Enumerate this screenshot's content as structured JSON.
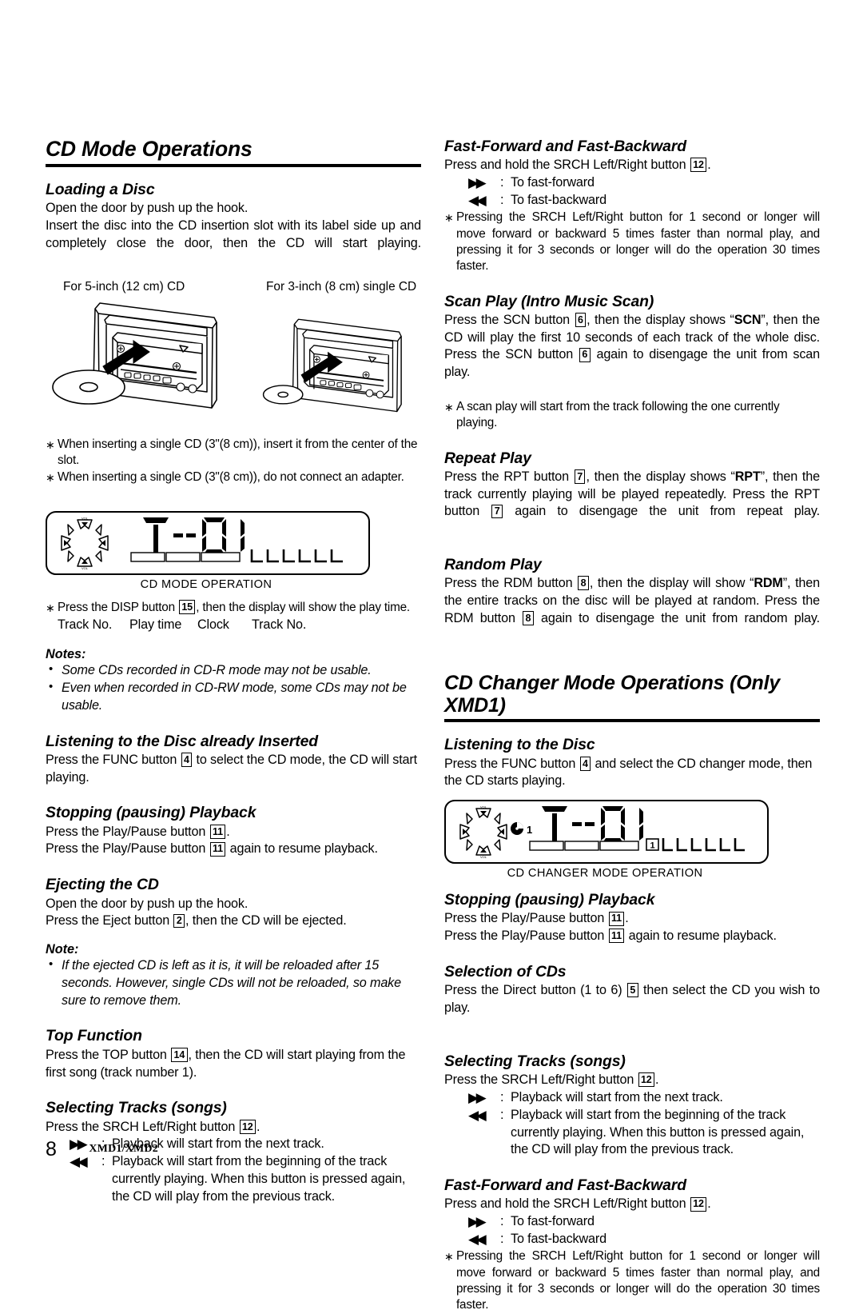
{
  "page": {
    "number": "8",
    "model": "XMD1/XMD2"
  },
  "left_column": {
    "main_heading": "CD Mode Operations",
    "sections": [
      {
        "heading": "Loading a Disc",
        "lines": [
          "Open the door by push up the hook.",
          "Insert the disc into the CD insertion slot with its label side up and completely close the door, then the CD will start playing."
        ]
      }
    ],
    "figure": {
      "caption_left": "For 5-inch (12 cm) CD",
      "caption_right": "For 3-inch (8 cm) single CD",
      "icon_left": "car-stereo-with-12cm-disc",
      "icon_right": "car-stereo-with-8cm-disc"
    },
    "figure_notes": [
      "When inserting a single CD (3\"(8 cm)), insert it from the center of the slot.",
      "When inserting a single CD (3\"(8 cm)), do not connect an adapter."
    ],
    "lcd": {
      "display_text": "T--01",
      "caption": "CD MODE OPERATION",
      "rosette_top_label": "VOL",
      "rosette_bottom_label": "VOL"
    },
    "lcd_note": "Press the DISP button",
    "lcd_note_ref": "15",
    "lcd_note_tail": ", then the display will show the play time.",
    "lcd_note_sequence": [
      "Track No.",
      "Play time",
      "Clock",
      "Track No."
    ],
    "notes_block": {
      "title": "Notes:",
      "items": [
        "Some CDs recorded in CD-R mode may not be usable.",
        "Even when recorded in CD-RW mode, some CDs may not be usable."
      ]
    },
    "listening_inserted": {
      "heading": "Listening to the Disc already Inserted",
      "text_pre": "Press the FUNC button",
      "ref": "4",
      "text_post": "to select the CD mode, the CD will start playing."
    },
    "stopping": {
      "heading": "Stopping (pausing) Playback",
      "line1_pre": "Press the Play/Pause button",
      "line1_ref": "11",
      "line1_post": ".",
      "line2_pre": "Press the Play/Pause button",
      "line2_ref": "11",
      "line2_post": "again to resume playback."
    },
    "ejecting": {
      "heading": "Ejecting the CD",
      "line1": "Open the door by push up the hook.",
      "line2_pre": "Press the Eject button",
      "line2_ref": "2",
      "line2_post": ", then the CD will be ejected."
    },
    "eject_note": {
      "title": "Note:",
      "item": "If the ejected CD is left as it is, it will be reloaded after 15 seconds. However, single CDs will not be reloaded, so make sure to remove them."
    },
    "top_function": {
      "heading": "Top Function",
      "text_pre": "Press the TOP button",
      "ref": "14",
      "text_post": ", then the CD will start playing from the first song (track number 1)."
    },
    "selecting_tracks": {
      "heading": "Selecting Tracks (songs)",
      "intro_pre": "Press the SRCH Left/Right button",
      "intro_ref": "12",
      "intro_post": ".",
      "rows": [
        {
          "icon": "fast-forward-icon",
          "glyph": "▶▶",
          "colon": ":",
          "text": "Playback will start from the next track."
        },
        {
          "icon": "rewind-icon",
          "glyph": "◀◀",
          "colon": ":",
          "text": "Playback will start from the beginning of the track currently playing. When this button is pressed again, the CD will play from the previous track."
        }
      ]
    }
  },
  "right_column": {
    "fast_forward_top": {
      "heading": "Fast-Forward and Fast-Backward",
      "intro_pre": "Press and hold the SRCH Left/Right button",
      "intro_ref": "12",
      "intro_post": ".",
      "rows": [
        {
          "icon": "fast-forward-icon",
          "glyph": "▶▶",
          "colon": ":",
          "text": "To fast-forward"
        },
        {
          "icon": "rewind-icon",
          "glyph": "◀◀",
          "colon": ":",
          "text": "To fast-backward"
        }
      ],
      "note": "Pressing the SRCH Left/Right button for 1 second or longer will move forward or backward 5 times faster than normal play, and pressing it for 3 seconds or longer will do the operation 30 times faster."
    },
    "scan_play": {
      "heading": "Scan Play (Intro Music Scan)",
      "seg1": "Press the SCN button",
      "ref1": "6",
      "seg2": ", then the display shows “",
      "bold1": "SCN",
      "seg3": "”, then the CD will play the first 10 seconds of each track of the whole disc. Press the SCN button",
      "ref2": "6",
      "seg4": "again to disengage the unit from scan play.",
      "note": "A scan play will start from the track following the one currently playing."
    },
    "repeat_play": {
      "heading": "Repeat Play",
      "seg1": "Press the RPT button",
      "ref1": "7",
      "seg2": ", then the display shows “",
      "bold1": "RPT",
      "seg3": "”, then the track currently playing will be played repeatedly. Press the RPT button",
      "ref2": "7",
      "seg4": "again to disengage the unit from repeat play."
    },
    "random_play": {
      "heading": "Random Play",
      "seg1": "Press the RDM button",
      "ref1": "8",
      "seg2": ", then the display will show “",
      "bold1": "RDM",
      "seg3": "”, then the entire tracks on the disc will be played at random. Press the RDM button",
      "ref2": "8",
      "seg4": "again to disengage the unit from random play."
    },
    "changer_heading": "CD Changer Mode Operations (Only XMD1)",
    "listening_disc": {
      "heading": "Listening to the Disc",
      "text_pre": "Press the FUNC button",
      "ref": "4",
      "text_post": "and select the CD changer mode, then the CD starts playing."
    },
    "lcd": {
      "display_text": "T--01",
      "caption": "CD CHANGER MODE OPERATION",
      "disc_indicator": "1",
      "track_indicator": "1"
    },
    "stopping": {
      "heading": "Stopping (pausing) Playback",
      "line1_pre": "Press the Play/Pause button",
      "line1_ref": "11",
      "line1_post": ".",
      "line2_pre": "Press the Play/Pause button",
      "line2_ref": "11",
      "line2_post": "again to resume playback."
    },
    "selection_cds": {
      "heading": "Selection of CDs",
      "text_pre": "Press the Direct button (1 to 6)",
      "ref": "5",
      "text_post": "then select the CD you wish to play."
    },
    "selecting_tracks": {
      "heading": "Selecting Tracks (songs)",
      "intro_pre": "Press the SRCH Left/Right button",
      "intro_ref": "12",
      "intro_post": ".",
      "rows": [
        {
          "icon": "fast-forward-icon",
          "glyph": "▶▶",
          "colon": ":",
          "text": "Playback will start from the next track."
        },
        {
          "icon": "rewind-icon",
          "glyph": "◀◀",
          "colon": ":",
          "text": "Playback will start from the beginning of the track currently playing. When this button is pressed again, the CD will play from the previous track."
        }
      ]
    },
    "fast_forward_bottom": {
      "heading": "Fast-Forward and Fast-Backward",
      "intro_pre": "Press and hold the SRCH Left/Right button",
      "intro_ref": "12",
      "intro_post": ".",
      "rows": [
        {
          "icon": "fast-forward-icon",
          "glyph": "▶▶",
          "colon": ":",
          "text": "To fast-forward"
        },
        {
          "icon": "rewind-icon",
          "glyph": "◀◀",
          "colon": ":",
          "text": "To fast-backward"
        }
      ],
      "note": "Pressing the SRCH Left/Right button for 1 second or longer will move forward or backward 5 times faster than normal play, and pressing it for 3 seconds or longer will do the operation 30 times faster."
    }
  }
}
